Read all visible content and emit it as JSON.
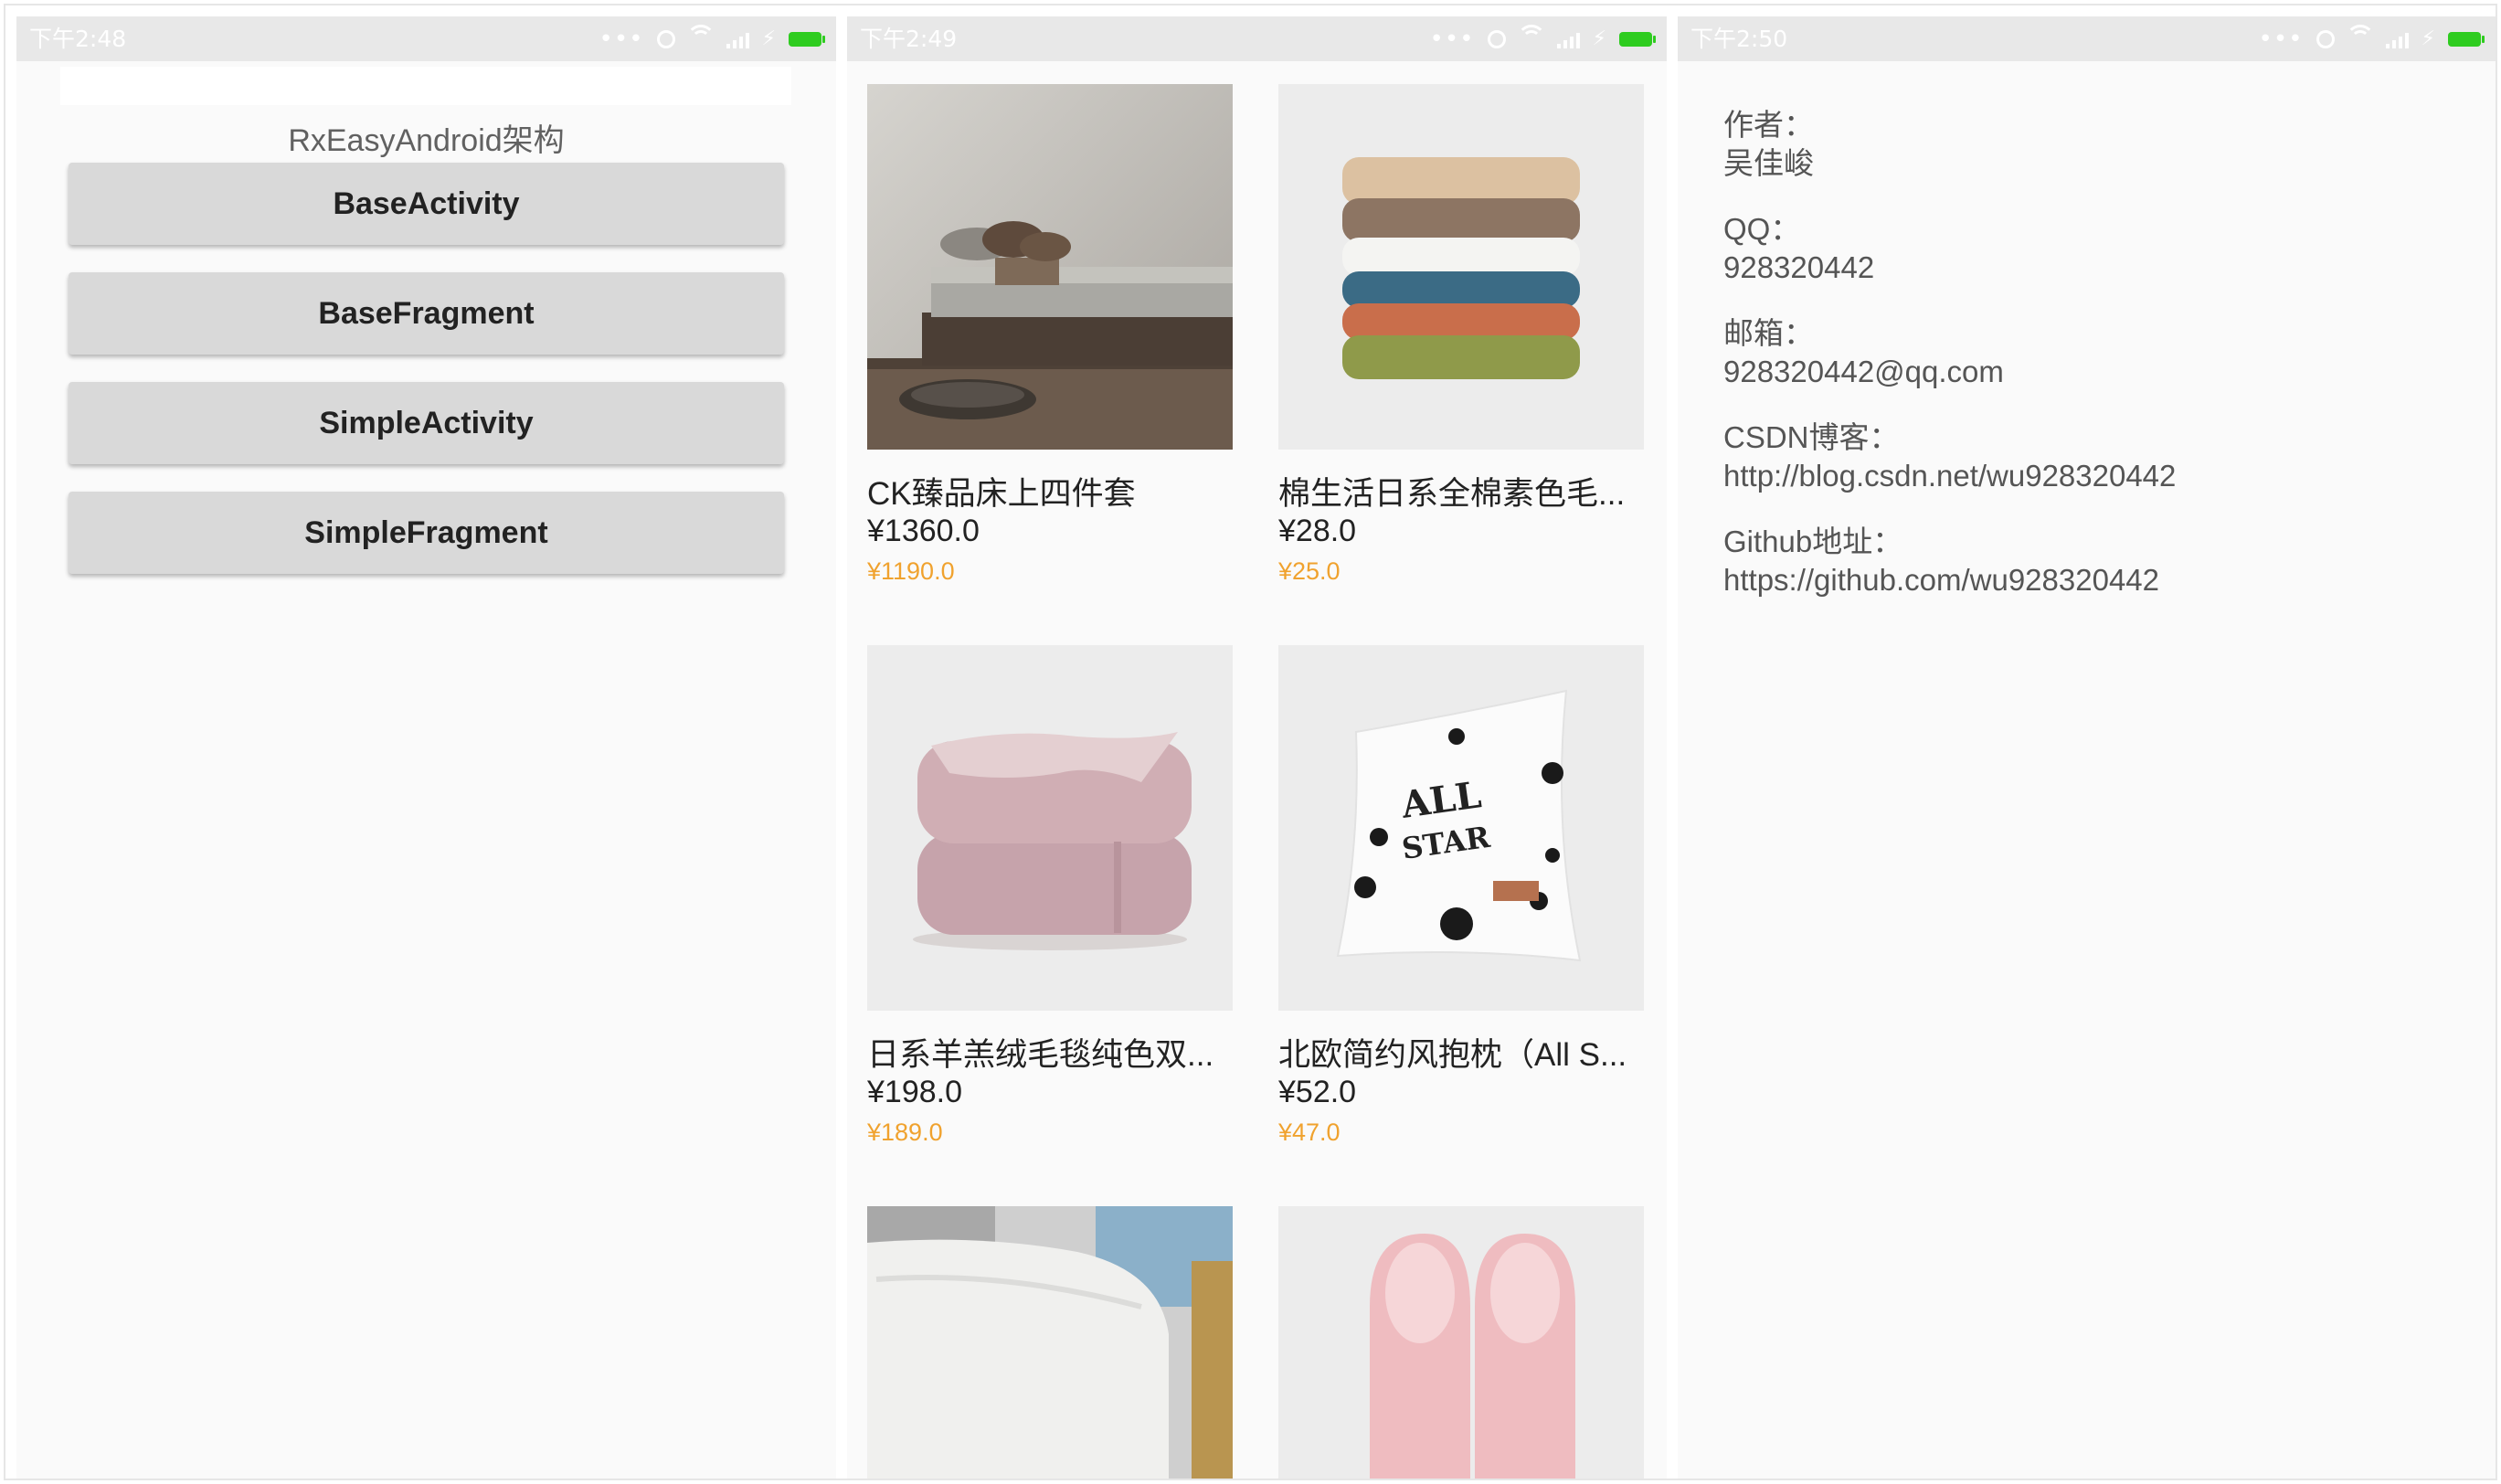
{
  "screens": [
    {
      "status_time": "下午2:48",
      "title": "RxEasyAndroid架构",
      "buttons": [
        "BaseActivity",
        "BaseFragment",
        "SimpleActivity",
        "SimpleFragment"
      ]
    },
    {
      "status_time": "下午2:49",
      "products": [
        {
          "name": "CK臻品床上四件套",
          "price": "¥1360.0",
          "original_price": "¥1190.0",
          "image": "bedding-set-image"
        },
        {
          "name": "棉生活日系全棉素色毛...",
          "price": "¥28.0",
          "original_price": "¥25.0",
          "image": "towel-stack-image"
        },
        {
          "name": "日系羊羔绒毛毯纯色双...",
          "price": "¥198.0",
          "original_price": "¥189.0",
          "image": "blanket-image"
        },
        {
          "name": "北欧简约风抱枕（All S...",
          "price": "¥52.0",
          "original_price": "¥47.0",
          "image": "pillow-image",
          "pillow_text_1": "ALL",
          "pillow_text_2": "STAR"
        },
        {
          "name": "",
          "price": "",
          "original_price": "",
          "image": "memory-pillow-image"
        },
        {
          "name": "",
          "price": "",
          "original_price": "",
          "image": "slippers-image"
        }
      ]
    },
    {
      "status_time": "下午2:50",
      "info": [
        {
          "label": "作者：",
          "value": "吴佳峻"
        },
        {
          "label": "QQ：",
          "value": "928320442"
        },
        {
          "label": "邮箱：",
          "value": "928320442@qq.com"
        },
        {
          "label": "CSDN博客：",
          "value": "http://blog.csdn.net/wu928320442"
        },
        {
          "label": "Github地址：",
          "value": "https://github.com/wu928320442"
        }
      ]
    }
  ],
  "colors": {
    "status_bar": "#e8e8e8",
    "battery": "#2ecc1f",
    "button": "#d9d9d9",
    "original_price": "#f0a22e",
    "background": "#fafafa"
  }
}
